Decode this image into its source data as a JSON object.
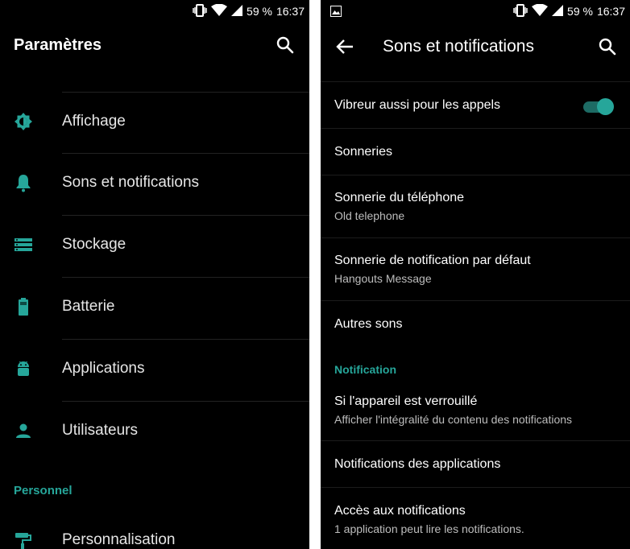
{
  "status": {
    "battery": "59 %",
    "time": "16:37"
  },
  "left": {
    "title": "Paramètres",
    "items": [
      {
        "label": "Affichage",
        "icon": "brightness-icon"
      },
      {
        "label": "Sons et notifications",
        "icon": "bell-icon"
      },
      {
        "label": "Stockage",
        "icon": "storage-icon"
      },
      {
        "label": "Batterie",
        "icon": "battery-icon"
      },
      {
        "label": "Applications",
        "icon": "android-icon"
      },
      {
        "label": "Utilisateurs",
        "icon": "person-icon"
      }
    ],
    "section": "Personnel",
    "personal_items": [
      {
        "label": "Personnalisation",
        "icon": "paint-roller-icon"
      }
    ]
  },
  "right": {
    "title": "Sons et notifications",
    "items": [
      {
        "title": "Vibreur aussi pour les appels",
        "toggle": true
      },
      {
        "title": "Sonneries"
      },
      {
        "title": "Sonnerie du téléphone",
        "subtitle": "Old telephone"
      },
      {
        "title": "Sonnerie de notification par défaut",
        "subtitle": "Hangouts Message"
      },
      {
        "title": "Autres sons"
      }
    ],
    "section": "Notification",
    "notif_items": [
      {
        "title": "Si l'appareil est verrouillé",
        "subtitle": "Afficher l'intégralité du contenu des notifications"
      },
      {
        "title": "Notifications des applications"
      },
      {
        "title": "Accès aux notifications",
        "subtitle": "1 application peut lire les notifications."
      }
    ]
  },
  "colors": {
    "accent": "#26a69a",
    "background": "#000000"
  }
}
